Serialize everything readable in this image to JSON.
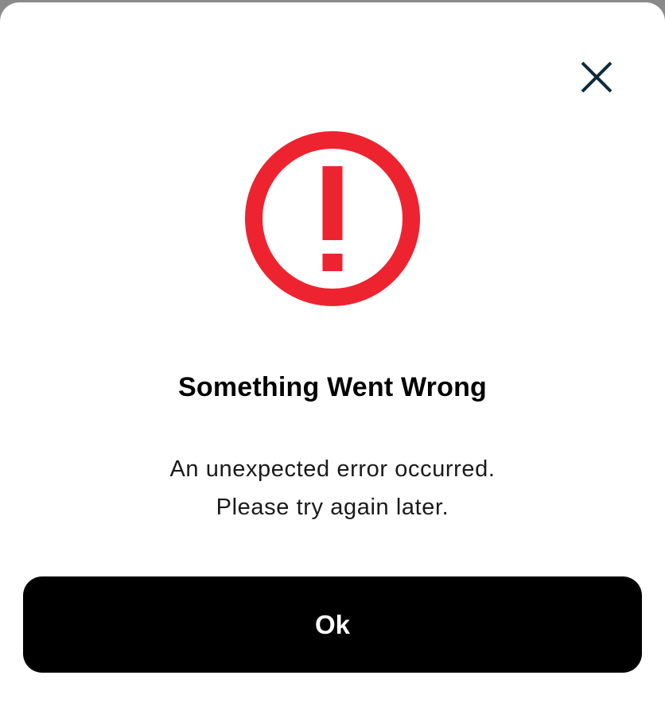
{
  "dialog": {
    "title": "Something Went Wrong",
    "message_lines": [
      "An unexpected error occurred.",
      "Please try again later."
    ],
    "ok_label": "Ok",
    "close_icon": "close-icon",
    "alert_icon": "alert-circle-icon"
  },
  "colors": {
    "alert": "#ee2330",
    "close": "#0f2a3d",
    "button_bg": "#000000",
    "button_text": "#ffffff"
  }
}
